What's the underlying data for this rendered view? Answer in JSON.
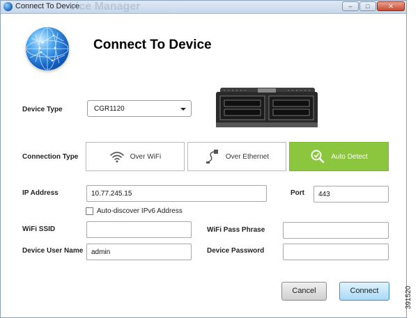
{
  "window": {
    "title": "Connect To Device",
    "background_title": "vice Manager",
    "buttons": {
      "minimize": "–",
      "maximize": "□",
      "close": "✕"
    }
  },
  "header": {
    "title": "Connect To Device",
    "icon": "globe-icon"
  },
  "device": {
    "type_label": "Device Type",
    "selected": "CGR1120"
  },
  "connection": {
    "label": "Connection Type",
    "options": [
      {
        "label": "Over WiFi",
        "icon": "wifi-icon",
        "active": false
      },
      {
        "label": "Over Ethernet",
        "icon": "ethernet-cable-icon",
        "active": false
      },
      {
        "label": "Auto Detect",
        "icon": "auto-detect-icon",
        "active": true
      }
    ],
    "active_color": "#8cc63f"
  },
  "form": {
    "ip_label": "IP Address",
    "ip_value": "10.77.245.15",
    "port_label": "Port",
    "port_value": "443",
    "ipv6_label": "Auto-discover IPv6 Address",
    "ipv6_checked": false,
    "wifi_ssid_label": "WiFi SSID",
    "wifi_ssid_value": "",
    "wifi_pass_label": "WiFi Pass Phrase",
    "wifi_pass_value": "",
    "user_label": "Device User Name",
    "user_value": "admin",
    "password_label": "Device Password",
    "password_value": ""
  },
  "actions": {
    "cancel": "Cancel",
    "connect": "Connect"
  },
  "figure_id": "391520"
}
